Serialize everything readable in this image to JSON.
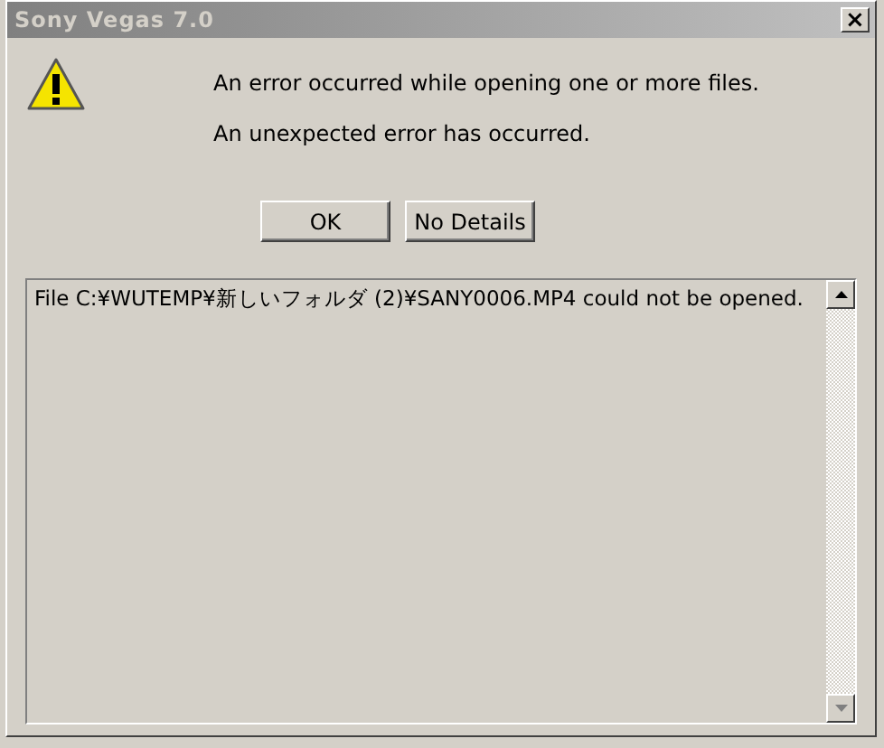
{
  "window": {
    "title": "Sony Vegas 7.0",
    "close": "×"
  },
  "messages": [
    "An error occurred while opening one or more files.",
    "An unexpected error has occurred."
  ],
  "buttons": [
    {
      "label": "OK"
    },
    {
      "label": "No Details"
    }
  ],
  "details": {
    "text": "File C:¥WUTEMP¥新しいフォルダ (2)¥SANY0006.MP4 could not be opened."
  }
}
